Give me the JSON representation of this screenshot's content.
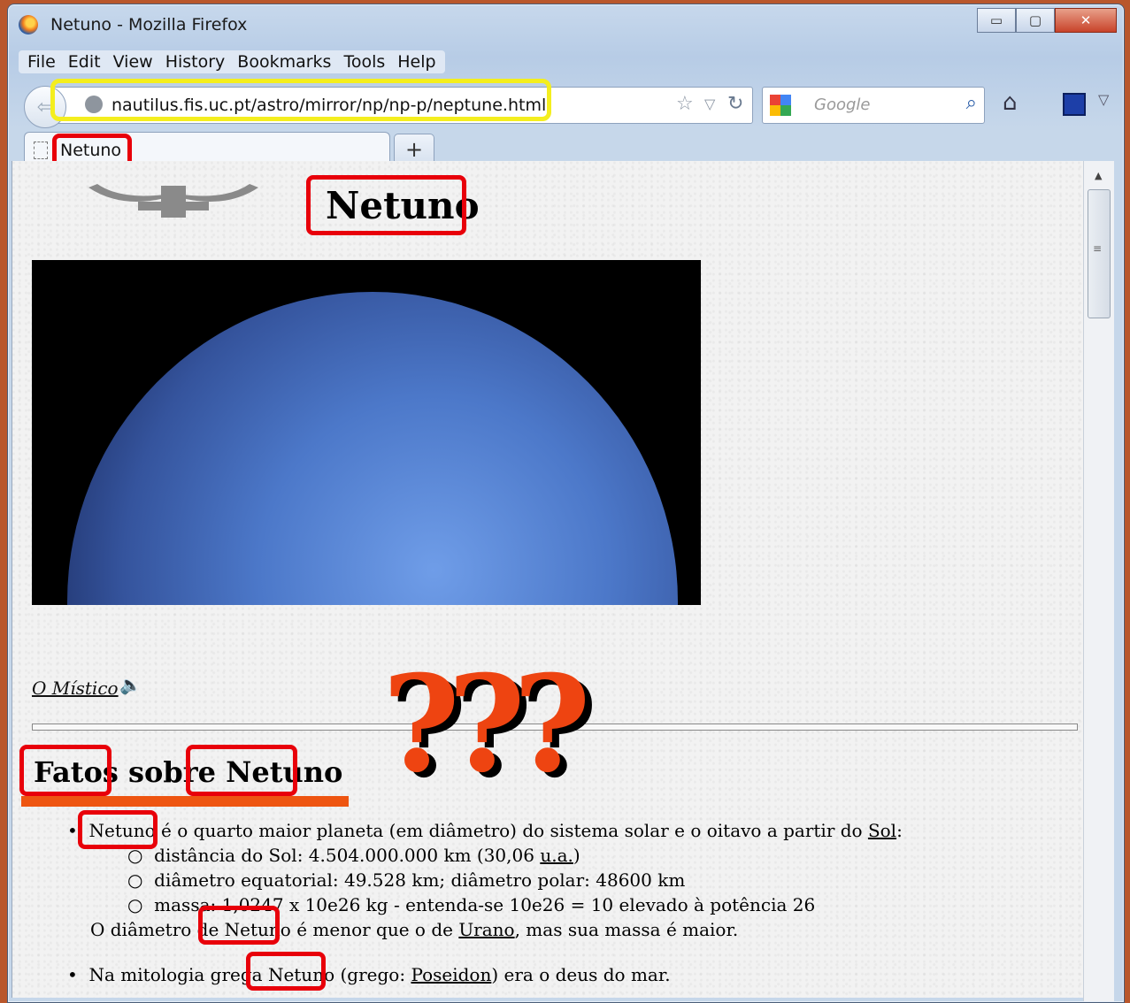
{
  "window": {
    "title": "Netuno - Mozilla Firefox",
    "minimize": "▭",
    "maximize": "▢",
    "close": "✕"
  },
  "menu": [
    "File",
    "Edit",
    "View",
    "History",
    "Bookmarks",
    "Tools",
    "Help"
  ],
  "navbar": {
    "url": "nautilus.fis.uc.pt/astro/mirror/np/np-p/neptune.html",
    "search_placeholder": "Google"
  },
  "tabs": [
    {
      "label": "Netuno"
    }
  ],
  "new_tab": "+",
  "page": {
    "title": "Netuno",
    "audio_link": "O Místico ",
    "question_marks": "???",
    "facts_heading_a": "Fatos",
    "facts_heading_b": " sobre ",
    "facts_heading_c": "Netuno",
    "item1_link": "Netuno",
    "item1_text": " é o quarto maior planeta (em diâmetro) do sistema solar e o oitavo a partir do ",
    "item1_sol": "Sol",
    "item1_end": ":",
    "sub1_a": "distância do Sol: 4.504.000.000 km (30,06 ",
    "sub1_link": "u.a.",
    "sub1_b": ")",
    "sub2": "diâmetro equatorial: 49.528 km; diâmetro polar: 48600 km",
    "sub3": "massa: 1,0247 x 10e26 kg - entenda-se 10e26 = 10 elevado à potência 26",
    "para_a": "O diâmetro de ",
    "para_link": "Netuno",
    "para_b": " é menor que o de ",
    "para_urano": "Urano",
    "para_c": ", mas sua massa é maior.",
    "item2_a": "Na mitologia grega ",
    "item2_link": "Netuno",
    "item2_b": " (grego: ",
    "item2_poseidon": "Poseidon",
    "item2_c": ") era o deus do mar."
  },
  "colors": {
    "highlight_yellow": "#f4ee1e",
    "highlight_red": "#e8000a",
    "question_orange": "#ee4411"
  }
}
